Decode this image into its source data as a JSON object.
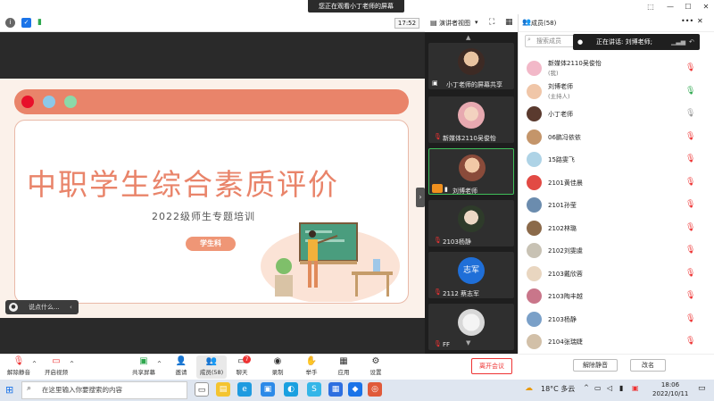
{
  "titlebar": {
    "share_banner": "您正在观看小丁老师的屏幕"
  },
  "meeting_strip": {
    "elapsed": "17:52",
    "view_label": "演讲者视图",
    "panel_title": "成员(58)"
  },
  "slide": {
    "title": "中职学生综合素质评价",
    "subtitle": "2022级师生专题培训",
    "badge": "学生科",
    "colors": {
      "accent": "#e9846a",
      "dot_red": "#e8102a",
      "dot_blue": "#8dc8e8",
      "dot_green": "#8bd9a8"
    }
  },
  "comment": {
    "placeholder": "说点什么..."
  },
  "thumbnails": [
    {
      "label": "小丁老师的屏幕共享"
    },
    {
      "label": "新媒体2110吴俊怡"
    },
    {
      "label": "刘博老师"
    },
    {
      "label": "2103杨静"
    },
    {
      "label": "2112 蔡志军",
      "avatar_text": "志军"
    },
    {
      "label": "FF"
    }
  ],
  "participants_panel": {
    "search_placeholder": "搜索成员",
    "speaking": "正在讲话: 刘博老师;",
    "rows": [
      {
        "name": "新媒体2110吴俊怡",
        "sub": "(我)"
      },
      {
        "name": "刘博老师",
        "sub": "(主持人)"
      },
      {
        "name": "小丁老师"
      },
      {
        "name": "06鹏冯依依"
      },
      {
        "name": "15路雯飞"
      },
      {
        "name": "2101黄佳晨"
      },
      {
        "name": "2101孙莹"
      },
      {
        "name": "2102林璐"
      },
      {
        "name": "2102刘雯虞"
      },
      {
        "name": "2103戴欣蓉"
      },
      {
        "name": "2103陶丰越"
      },
      {
        "name": "2103杨静"
      },
      {
        "name": "2104张瑞婕"
      }
    ],
    "unmute_all": "解除静音",
    "rename": "改名"
  },
  "toolbar": {
    "unmute": "解除静音",
    "video": "开启视频",
    "share": "共享屏幕",
    "invite": "邀请",
    "members": "成员(58)",
    "chat": "聊天",
    "record": "录制",
    "hand": "举手",
    "apps": "应用",
    "settings": "设置",
    "chat_badge": "7",
    "leave": "离开会议"
  },
  "taskbar": {
    "search_placeholder": "在这里输入你要搜索的内容",
    "weather": "18°C 多云",
    "time": "18:06",
    "date": "2022/10/11"
  }
}
